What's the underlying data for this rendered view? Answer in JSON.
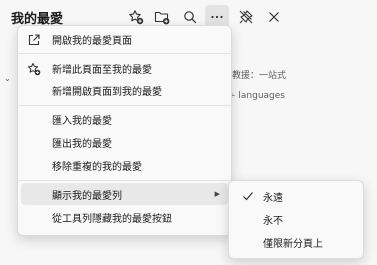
{
  "header": {
    "title": "我的最愛",
    "icons": [
      "add-favorite-icon",
      "add-folder-icon",
      "search-icon",
      "more-options-icon",
      "unpin-icon",
      "close-icon"
    ]
  },
  "background": {
    "snippet_1": "教援：一站式",
    "snippet_2": "+ languages"
  },
  "menu": {
    "items": [
      {
        "label": "開啟我的最愛頁面",
        "icon": "open-external-icon"
      },
      {
        "label": "新增此頁面至我的最愛",
        "icon": "add-favorite-icon"
      },
      {
        "label": "新增開啟頁面到我的最愛",
        "icon": ""
      },
      {
        "label": "匯入我的最愛",
        "icon": ""
      },
      {
        "label": "匯出我的最愛",
        "icon": ""
      },
      {
        "label": "移除重複的我的最愛",
        "icon": ""
      },
      {
        "label": "顯示我的最愛列",
        "icon": "",
        "has_submenu": true
      },
      {
        "label": "從工具列隱藏我的最愛按鈕",
        "icon": ""
      }
    ]
  },
  "submenu": {
    "items": [
      {
        "label": "永遠",
        "checked": true
      },
      {
        "label": "永不",
        "checked": false
      },
      {
        "label": "僅限新分頁上",
        "checked": false
      }
    ]
  }
}
